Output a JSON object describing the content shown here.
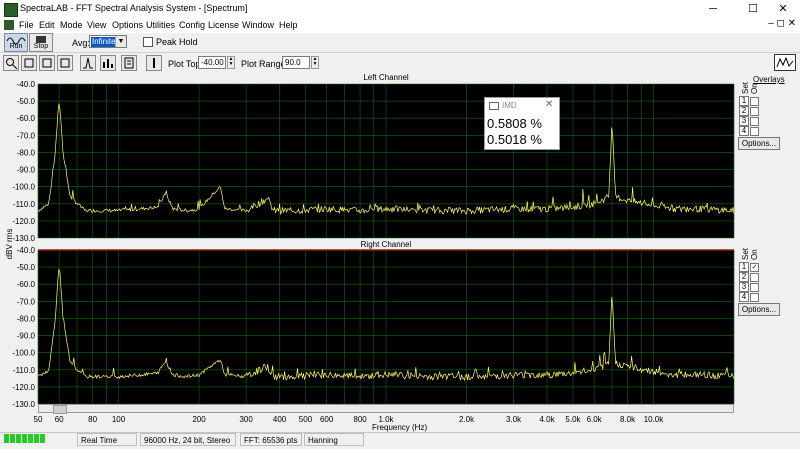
{
  "titlebar": {
    "title": "SpectraLAB - FFT Spectral Analysis System - [Spectrum]",
    "minimize": "─",
    "maximize": "☐",
    "close": "✕"
  },
  "menu": [
    "File",
    "Edit",
    "Mode",
    "View",
    "Options",
    "Utilities",
    "Config",
    "License",
    "Window",
    "Help"
  ],
  "mdi_controls": "–  ◻  ✕",
  "toolbar": {
    "run_label": "Run",
    "stop_label": "Stop",
    "avg_label": "Avg:",
    "avg_value": "Infinite",
    "peak_hold_label": "Peak Hold"
  },
  "toolbar2": {
    "plot_top_label": "Plot Top:",
    "plot_top_value": "-40.00",
    "plot_range_label": "Plot Range:",
    "plot_range_value": "90.0"
  },
  "channels": {
    "left_title": "Left Channel",
    "right_title": "Right Channel"
  },
  "overlays": {
    "header": "Overlays",
    "set_label": "Set",
    "on_label": "On",
    "numbers": [
      "1",
      "2",
      "3",
      "4"
    ],
    "right_checked": [
      true,
      false,
      false,
      false
    ],
    "options_label": "Options..."
  },
  "imd_window": {
    "title": "IMD",
    "value1": "0.5808 %",
    "value2": "0.5018 %"
  },
  "statusbar": {
    "mode": "Real Time",
    "format": "96000 Hz, 24 bit, Stereo",
    "fft": "FFT: 65536 pts",
    "window": "Hanning"
  },
  "colors": {
    "plot_bg": "#000000",
    "grid": "#116611",
    "trace": "#ffff66",
    "channel_divider": "#cc0000"
  },
  "chart_data": {
    "type": "line",
    "ylabel": "dBV rms",
    "xlabel": "Frequency (Hz)",
    "x_scale": "log",
    "xlim": [
      50,
      20000
    ],
    "ylim": [
      -130,
      -40
    ],
    "y_ticks": [
      "-40.0",
      "-50.0",
      "-60.0",
      "-70.0",
      "-80.0",
      "-90.0",
      "-100.0",
      "-110.0",
      "-120.0",
      "-130.0"
    ],
    "x_ticks": [
      {
        "label": "50",
        "value": 50
      },
      {
        "label": "60",
        "value": 60
      },
      {
        "label": "80",
        "value": 80
      },
      {
        "label": "100",
        "value": 100
      },
      {
        "label": "200",
        "value": 200
      },
      {
        "label": "300",
        "value": 300
      },
      {
        "label": "400",
        "value": 400
      },
      {
        "label": "500",
        "value": 500
      },
      {
        "label": "600",
        "value": 600
      },
      {
        "label": "800",
        "value": 800
      },
      {
        "label": "1.0k",
        "value": 1000
      },
      {
        "label": "2.0k",
        "value": 2000
      },
      {
        "label": "3.0k",
        "value": 3000
      },
      {
        "label": "4.0k",
        "value": 4000
      },
      {
        "label": "5.0k",
        "value": 5000
      },
      {
        "label": "6.0k",
        "value": 6000
      },
      {
        "label": "8.0k",
        "value": 8000
      },
      {
        "label": "10.0k",
        "value": 10000
      }
    ],
    "series": [
      {
        "name": "Left Channel",
        "points": [
          [
            50,
            -114
          ],
          [
            55,
            -110
          ],
          [
            58,
            -80
          ],
          [
            59.5,
            -55
          ],
          [
            60,
            -51
          ],
          [
            60.5,
            -55
          ],
          [
            62,
            -80
          ],
          [
            66,
            -106
          ],
          [
            75,
            -114
          ],
          [
            100,
            -114
          ],
          [
            120,
            -113
          ],
          [
            140,
            -112
          ],
          [
            150,
            -104
          ],
          [
            160,
            -113
          ],
          [
            180,
            -114
          ],
          [
            200,
            -113
          ],
          [
            240,
            -100
          ],
          [
            250,
            -113
          ],
          [
            300,
            -114
          ],
          [
            360,
            -107
          ],
          [
            380,
            -114
          ],
          [
            450,
            -114
          ],
          [
            600,
            -113
          ],
          [
            800,
            -114
          ],
          [
            1000,
            -113
          ],
          [
            1500,
            -114
          ],
          [
            2000,
            -114
          ],
          [
            3000,
            -113
          ],
          [
            4000,
            -113
          ],
          [
            5000,
            -112
          ],
          [
            6000,
            -110
          ],
          [
            6800,
            -106
          ],
          [
            7000,
            -62
          ],
          [
            7200,
            -106
          ],
          [
            8000,
            -108
          ],
          [
            10000,
            -111
          ],
          [
            12000,
            -113
          ],
          [
            15000,
            -113
          ],
          [
            20000,
            -114
          ]
        ]
      },
      {
        "name": "Right Channel",
        "points": [
          [
            50,
            -114
          ],
          [
            55,
            -110
          ],
          [
            58,
            -80
          ],
          [
            59.5,
            -55
          ],
          [
            60,
            -50
          ],
          [
            60.5,
            -55
          ],
          [
            62,
            -80
          ],
          [
            66,
            -106
          ],
          [
            75,
            -114
          ],
          [
            100,
            -114
          ],
          [
            120,
            -113
          ],
          [
            140,
            -112
          ],
          [
            150,
            -105
          ],
          [
            160,
            -113
          ],
          [
            180,
            -114
          ],
          [
            200,
            -113
          ],
          [
            240,
            -104
          ],
          [
            250,
            -113
          ],
          [
            300,
            -114
          ],
          [
            360,
            -108
          ],
          [
            380,
            -114
          ],
          [
            450,
            -114
          ],
          [
            600,
            -113
          ],
          [
            800,
            -114
          ],
          [
            1000,
            -113
          ],
          [
            1500,
            -114
          ],
          [
            2000,
            -114
          ],
          [
            3000,
            -113
          ],
          [
            4000,
            -113
          ],
          [
            5000,
            -112
          ],
          [
            6000,
            -110
          ],
          [
            6800,
            -107
          ],
          [
            7000,
            -64
          ],
          [
            7200,
            -106
          ],
          [
            8000,
            -108
          ],
          [
            10000,
            -111
          ],
          [
            12000,
            -113
          ],
          [
            15000,
            -113
          ],
          [
            20000,
            -114
          ]
        ]
      }
    ]
  }
}
